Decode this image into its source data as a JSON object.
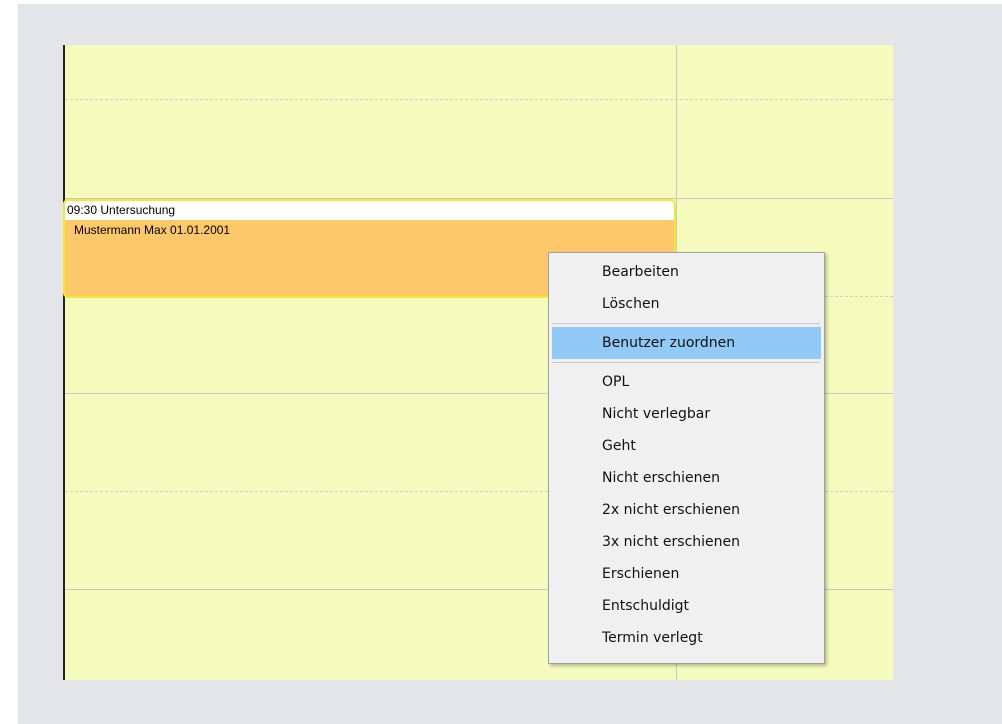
{
  "appointment": {
    "time_title": "09:30 Untersuchung",
    "patient": "Mustermann Max  01.01.2001"
  },
  "context_menu": {
    "group1": [
      "Bearbeiten",
      "Löschen"
    ],
    "group2": [
      "Benutzer zuordnen"
    ],
    "group3": [
      "OPL",
      "Nicht verlegbar",
      "Geht",
      "Nicht erschienen",
      "2x nicht erschienen",
      "3x nicht erschienen",
      "Erschienen",
      "Entschuldigt",
      "Termin verlegt"
    ],
    "highlighted": "Benutzer zuordnen"
  },
  "colors": {
    "calendar_background": "#f5fbbc",
    "appointment_fill": "#fdc86a",
    "appointment_border": "#f0ea30",
    "menu_highlight": "#91c9f7"
  }
}
